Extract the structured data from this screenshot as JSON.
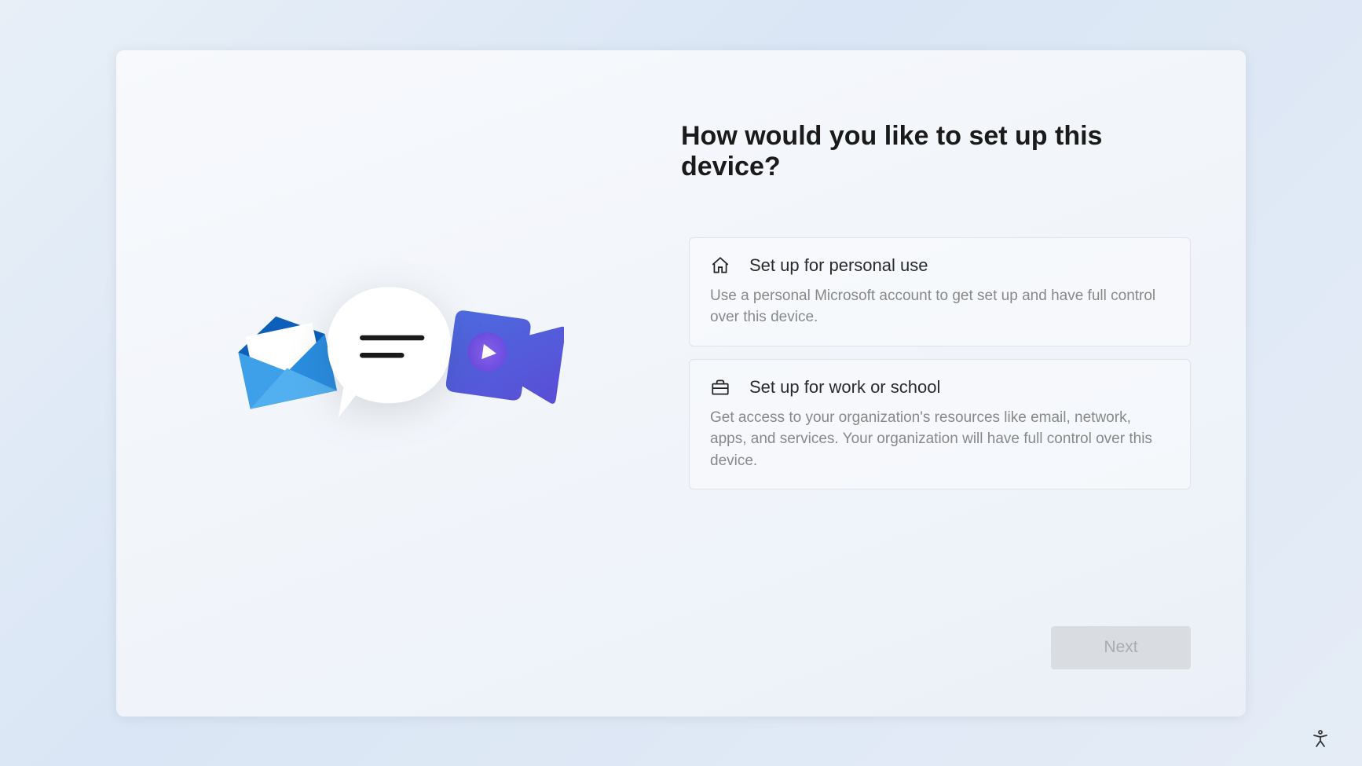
{
  "title": "How would you like to set up this device?",
  "options": {
    "personal": {
      "title": "Set up for personal use",
      "desc": "Use a personal Microsoft account to get set up and have full control over this device."
    },
    "work": {
      "title": "Set up for work or school",
      "desc": "Get access to your organization's resources like email, network, apps, and services. Your organization will have full control over this device."
    }
  },
  "buttons": {
    "next": "Next"
  }
}
